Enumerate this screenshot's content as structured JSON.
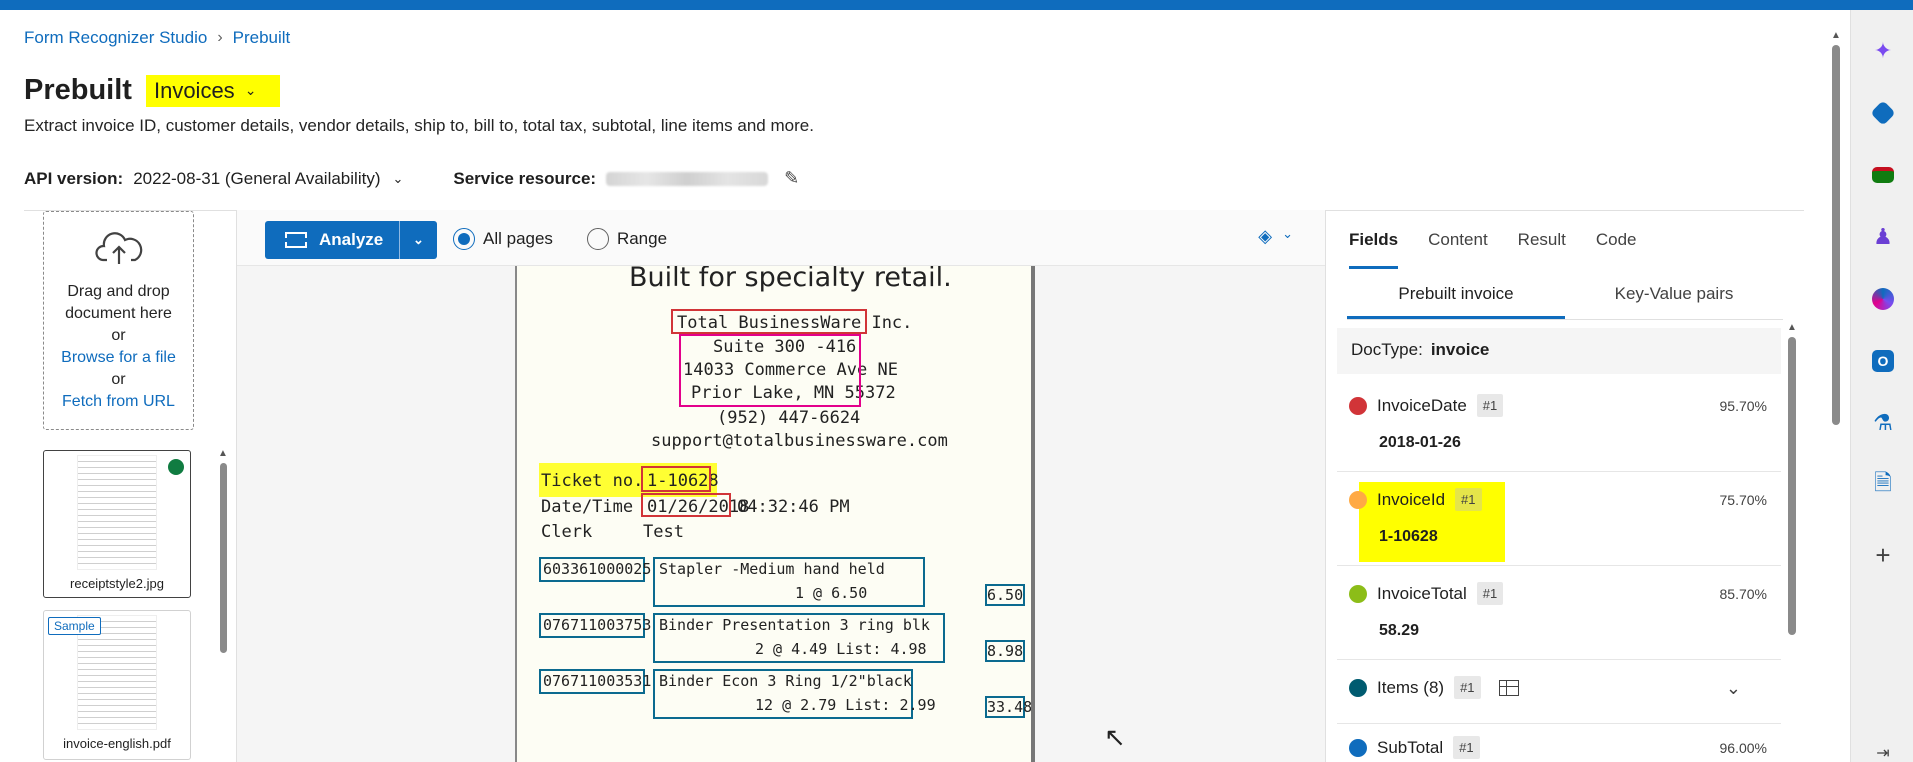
{
  "breadcrumb": {
    "root": "Form Recognizer Studio",
    "current": "Prebuilt"
  },
  "header": {
    "title": "Prebuilt",
    "model": "Invoices",
    "subtitle": "Extract invoice ID, customer details, vendor details, ship to, bill to, total tax, subtotal, line items and more."
  },
  "api": {
    "label": "API version:",
    "value": "2022-08-31 (General Availability)",
    "service_label": "Service resource:"
  },
  "upload": {
    "line1": "Drag and drop",
    "line2": "document here",
    "or1": "or",
    "browse": "Browse for a file",
    "or2": "or",
    "fetch": "Fetch from URL"
  },
  "thumbnails": [
    {
      "name": "receiptstyle2.jpg",
      "status_color": "#107c41"
    },
    {
      "name": "invoice-english.pdf",
      "badge": "Sample"
    }
  ],
  "toolbar": {
    "analyze": "Analyze",
    "all_pages": "All pages",
    "range": "Range"
  },
  "document": {
    "banner": "Built for specialty retail.",
    "company": "Total BusinessWare Inc.",
    "addr1": "Suite 300 -416",
    "addr2": "14033 Commerce Ave NE",
    "addr3": "Prior Lake, MN 55372",
    "phone": "(952) 447-6624",
    "email": "support@totalbusinessware.com",
    "ticket_label": "Ticket no.",
    "ticket_no": "1-10628",
    "date_label": "Date/Time",
    "date": "01/26/2018",
    "time": "04:32:46 PM",
    "clerk_label": "Clerk",
    "clerk": "Test",
    "items": [
      {
        "sku": "603361000025",
        "desc": "Stapler -Medium hand held",
        "qty": "1 @ 6.50",
        "amount": "6.50"
      },
      {
        "sku": "076711003753",
        "desc": "Binder Presentation 3 ring blk",
        "qty": "2 @ 4.49 List: 4.98",
        "amount": "8.98"
      },
      {
        "sku": "076711003531",
        "desc": "Binder Econ 3 Ring 1/2\"black",
        "qty": "12 @ 2.79 List: 2.99",
        "amount": "33.48"
      }
    ]
  },
  "panel": {
    "tabs": [
      "Fields",
      "Content",
      "Result",
      "Code"
    ],
    "subtabs": [
      "Prebuilt invoice",
      "Key-Value pairs"
    ],
    "doctype_label": "DocType:",
    "doctype": "invoice",
    "fields": [
      {
        "name": "InvoiceDate",
        "badge": "#1",
        "conf": "95.70%",
        "value": "2018-01-26",
        "color": "#d13438"
      },
      {
        "name": "InvoiceId",
        "badge": "#1",
        "conf": "75.70%",
        "value": "1-10628",
        "color": "#ffaa44"
      },
      {
        "name": "InvoiceTotal",
        "badge": "#1",
        "conf": "85.70%",
        "value": "58.29",
        "color": "#8cbd18"
      },
      {
        "name": "Items (8)",
        "badge": "#1",
        "color": "#005b70"
      },
      {
        "name": "SubTotal",
        "badge": "#1",
        "conf": "96.00%",
        "color": "#0f6cbd"
      }
    ]
  },
  "colors": {
    "accent": "#0f6cbd",
    "highlight": "#ffff00"
  },
  "rail_icons": [
    "copilot-icon",
    "tag-icon",
    "toolbox-icon",
    "people-icon",
    "m365-icon",
    "outlook-icon",
    "lab-icon",
    "web-icon",
    "add-icon",
    "collapse-icon"
  ]
}
